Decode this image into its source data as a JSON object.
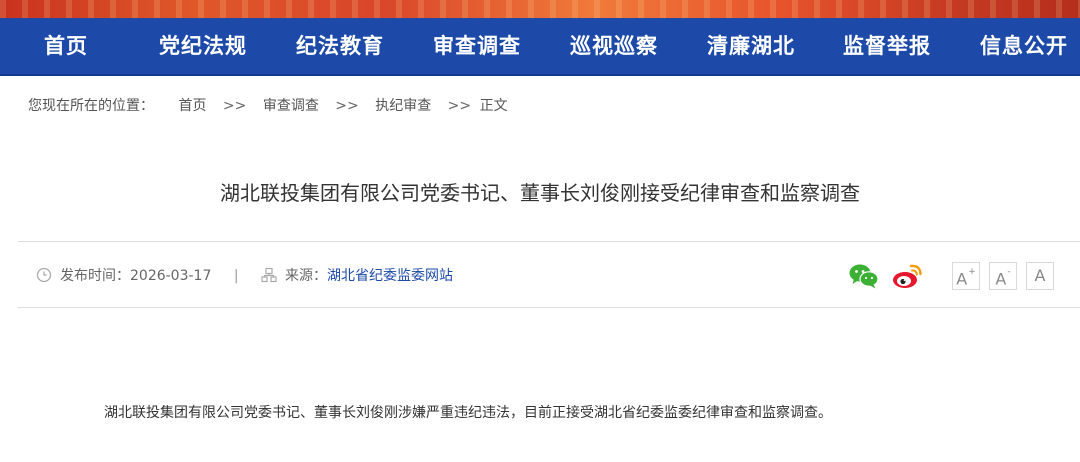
{
  "nav": {
    "items": [
      {
        "label": "首页"
      },
      {
        "label": "党纪法规"
      },
      {
        "label": "纪法教育"
      },
      {
        "label": "审查调查"
      },
      {
        "label": "巡视巡察"
      },
      {
        "label": "清廉湖北"
      },
      {
        "label": "监督举报"
      },
      {
        "label": "信息公开"
      }
    ]
  },
  "breadcrumb": {
    "prefix": "您现在所在的位置：",
    "items": [
      "首页",
      "审查调查",
      "执纪审查",
      "正文"
    ],
    "separator": ">>"
  },
  "article": {
    "title": "湖北联投集团有限公司党委书记、董事长刘俊刚接受纪律审查和监察调查",
    "meta": {
      "date_label": "发布时间：",
      "date": "2026-03-17",
      "divider": "|",
      "source_label": "来源：",
      "source": "湖北省纪委监委网站"
    },
    "body": "湖北联投集团有限公司党委书记、董事长刘俊刚涉嫌严重违纪违法，目前正接受湖北省纪委监委纪律审查和监察调查。"
  },
  "share": {
    "icons": [
      "wechat-icon",
      "weibo-icon"
    ]
  },
  "font_size_controls": {
    "increase": "A",
    "decrease": "A",
    "reset": "A",
    "increase_mark": "+",
    "decrease_mark": "-"
  },
  "colors": {
    "nav_bg": "#1d4aa8",
    "banner": "#d9452a",
    "wechat": "#3cb034",
    "weibo": "#e6162d"
  }
}
